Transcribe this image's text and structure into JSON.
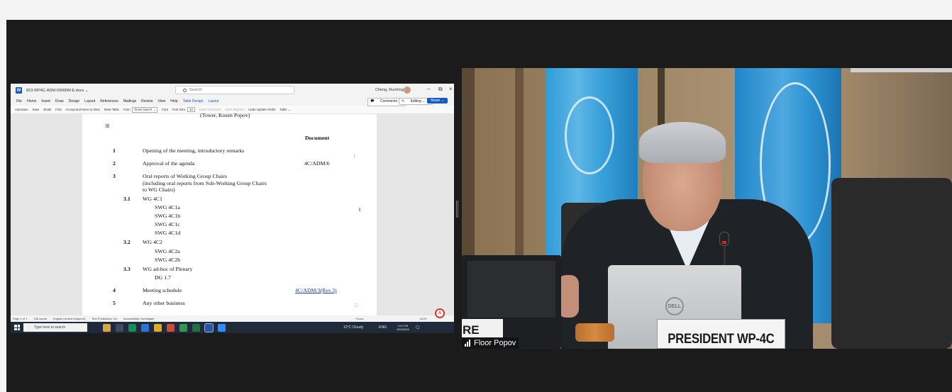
{
  "word": {
    "title": "823-WP4C-ADM-00000M-E.docx ⌄",
    "search_placeholder": "Search",
    "user": "Cheng, Ruohing",
    "menu": [
      "File",
      "Home",
      "Insert",
      "Draw",
      "Design",
      "Layout",
      "References",
      "Mailings",
      "Review",
      "View",
      "Help"
    ],
    "menu_active": [
      "Table Design",
      "Layout"
    ],
    "comments_label": "Comments",
    "editing_label": "Editing ⌄",
    "share_label": "Share ⌄",
    "ribbon": {
      "autosave": "AutoSave",
      "save": "Save",
      "email": "Email",
      "find": "Find",
      "accept": "Accept and Move to Next",
      "draw_table": "Draw Table",
      "font_label": "Font:",
      "font_value": "Times New R ⌄",
      "font_btn": "Font",
      "size_label": "Font Size:",
      "size_value": "10",
      "insert_comment": "Insert Comment",
      "dont_replace": "Don't Replace",
      "undo_update": "Undo Update Fields",
      "table": "Table ⌄"
    },
    "doc": {
      "partial_top": "(Tower, Kosen Popov)",
      "doc_header": "Document",
      "marker": "1",
      "items": [
        {
          "num": "1",
          "text": "Opening of the meeting, introductory remarks",
          "doc": ""
        },
        {
          "num": "2",
          "text": "Approval of the agenda",
          "doc": "4C/ADM/6"
        },
        {
          "num": "3",
          "text": "Oral reports of Working Group Chairs",
          "doc": ""
        }
      ],
      "item3_line2": "(including oral reports from Sub-Working Group Chairs",
      "item3_line3": "to WG Chairs)",
      "sub_31": {
        "num": "3.1",
        "text": "WG 4C1",
        "children": [
          "SWG 4C1a",
          "SWG 4C1b",
          "SWG 4C1c",
          "SWG 4C1d"
        ]
      },
      "sub_32": {
        "num": "3.2",
        "text": "WG 4C2",
        "children": [
          "SWG 4C2a",
          "SWG 4C2b"
        ]
      },
      "sub_33": {
        "num": "3.3",
        "text": "WG ad-hoc of Plenary",
        "children": [
          "DG 1.7"
        ]
      },
      "item4": {
        "num": "4",
        "text": "Meeting schedule",
        "doc": "4C/ADM/3(Rev.3)"
      },
      "item5": {
        "num": "5",
        "text": "Any other business"
      }
    },
    "status": {
      "page": "Page 1 of 1",
      "words": "136 words",
      "language": "English (United Kingdom)",
      "predictions": "Text Predictions: On",
      "accessibility": "Accessibility: Investigate",
      "focus": "Focus",
      "zoom": "110%"
    }
  },
  "taskbar": {
    "search": "Type here to search",
    "weather": "12°C Cloudy",
    "lang": "ENG",
    "time": "3:11 PM",
    "date": "4/26/2024"
  },
  "video": {
    "participant": "Floor Popov",
    "placard": "PRESIDENT WP-4C",
    "placard_left": "RE",
    "laptop_logo": "DELL"
  }
}
